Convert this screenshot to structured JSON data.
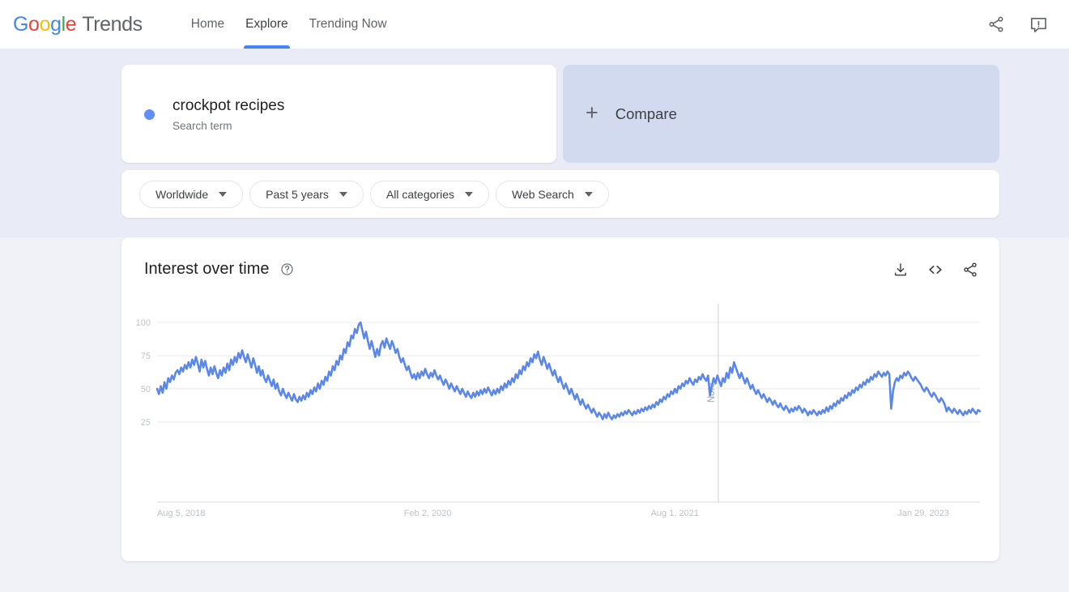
{
  "header": {
    "logo": {
      "google": "Google",
      "trends": "Trends"
    },
    "nav": [
      {
        "label": "Home",
        "active": false
      },
      {
        "label": "Explore",
        "active": true
      },
      {
        "label": "Trending Now",
        "active": false
      }
    ],
    "actions": [
      {
        "name": "share-icon",
        "label": "Share"
      },
      {
        "name": "feedback-icon",
        "label": "Send feedback"
      }
    ]
  },
  "search": {
    "term": "crockpot recipes",
    "type": "Search term",
    "dot_color": "#5e8ef7",
    "compare_label": "Compare",
    "compare_plus": "+"
  },
  "filters": [
    {
      "label": "Worldwide",
      "name": "region-filter"
    },
    {
      "label": "Past 5 years",
      "name": "time-filter"
    },
    {
      "label": "All categories",
      "name": "category-filter"
    },
    {
      "label": "Web Search",
      "name": "search-type-filter"
    }
  ],
  "chart_card": {
    "title": "Interest over time",
    "help": "?",
    "tools": [
      {
        "name": "download-icon",
        "label": "Download CSV"
      },
      {
        "name": "embed-icon",
        "label": "Embed"
      },
      {
        "name": "share-icon",
        "label": "Share"
      }
    ]
  },
  "chart_data": {
    "type": "line",
    "title": "Interest over time",
    "xlabel": "",
    "ylabel": "",
    "ylim": [
      0,
      108
    ],
    "yticks": [
      25,
      50,
      75,
      100
    ],
    "grid": true,
    "legend": false,
    "line_color": "#5b87e8",
    "xticks": [
      "Aug 5, 2018",
      "Feb 2, 2020",
      "Aug 1, 2021",
      "Jan 29, 2023"
    ],
    "xtick_positions": [
      0.0,
      0.3,
      0.6,
      0.9
    ],
    "annotations": [
      {
        "label": "Note",
        "x_fraction": 0.682,
        "type": "vertical-line"
      }
    ],
    "series": [
      {
        "name": "crockpot recipes",
        "values": [
          50,
          46,
          52,
          47,
          55,
          50,
          58,
          55,
          60,
          57,
          62,
          64,
          61,
          66,
          63,
          68,
          65,
          70,
          66,
          72,
          68,
          74,
          69,
          63,
          72,
          66,
          71,
          65,
          60,
          66,
          61,
          67,
          62,
          58,
          64,
          60,
          66,
          62,
          69,
          64,
          72,
          68,
          74,
          70,
          77,
          73,
          79,
          74,
          70,
          76,
          71,
          66,
          73,
          68,
          62,
          67,
          60,
          64,
          58,
          55,
          60,
          56,
          52,
          57,
          50,
          54,
          48,
          45,
          50,
          46,
          43,
          47,
          44,
          41,
          46,
          42,
          40,
          44,
          41,
          45,
          42,
          47,
          44,
          49,
          46,
          51,
          48,
          54,
          50,
          56,
          53,
          59,
          56,
          63,
          60,
          67,
          64,
          71,
          68,
          75,
          72,
          80,
          77,
          85,
          82,
          90,
          88,
          95,
          92,
          98,
          100,
          94,
          88,
          93,
          86,
          80,
          86,
          80,
          74,
          80,
          75,
          83,
          86,
          81,
          88,
          84,
          80,
          86,
          82,
          77,
          80,
          74,
          70,
          73,
          68,
          64,
          67,
          62,
          58,
          61,
          57,
          62,
          58,
          63,
          60,
          65,
          61,
          58,
          62,
          59,
          64,
          60,
          57,
          60,
          56,
          53,
          57,
          54,
          50,
          54,
          51,
          48,
          52,
          49,
          46,
          50,
          47,
          44,
          48,
          45,
          43,
          47,
          44,
          48,
          45,
          49,
          46,
          50,
          47,
          51,
          48,
          45,
          49,
          46,
          50,
          47,
          52,
          49,
          54,
          51,
          56,
          53,
          58,
          55,
          61,
          58,
          64,
          61,
          67,
          64,
          70,
          67,
          73,
          70,
          76,
          73,
          78,
          72,
          68,
          74,
          70,
          65,
          69,
          64,
          60,
          64,
          59,
          55,
          59,
          54,
          50,
          54,
          50,
          46,
          50,
          46,
          42,
          46,
          42,
          38,
          42,
          38,
          35,
          38,
          35,
          32,
          35,
          32,
          29,
          32,
          30,
          27,
          31,
          28,
          32,
          29,
          27,
          30,
          28,
          31,
          29,
          32,
          30,
          33,
          31,
          34,
          32,
          30,
          33,
          31,
          34,
          32,
          35,
          33,
          36,
          34,
          37,
          35,
          38,
          36,
          40,
          38,
          42,
          40,
          44,
          42,
          46,
          44,
          48,
          46,
          50,
          47,
          52,
          50,
          54,
          52,
          56,
          54,
          58,
          55,
          53,
          57,
          55,
          59,
          57,
          61,
          58,
          56,
          60,
          45,
          52,
          58,
          54,
          60,
          56,
          52,
          58,
          55,
          62,
          58,
          66,
          62,
          70,
          66,
          62,
          58,
          62,
          58,
          54,
          58,
          54,
          50,
          53,
          49,
          46,
          49,
          46,
          43,
          46,
          43,
          40,
          43,
          41,
          38,
          41,
          38,
          36,
          39,
          36,
          34,
          37,
          35,
          32,
          35,
          33,
          36,
          34,
          37,
          35,
          32,
          35,
          33,
          30,
          33,
          31,
          34,
          32,
          30,
          33,
          31,
          34,
          32,
          36,
          33,
          37,
          35,
          39,
          37,
          41,
          39,
          43,
          41,
          45,
          43,
          47,
          45,
          49,
          47,
          51,
          49,
          53,
          51,
          55,
          53,
          57,
          55,
          59,
          57,
          61,
          59,
          63,
          61,
          59,
          62,
          60,
          63,
          61,
          35,
          48,
          55,
          58,
          56,
          60,
          58,
          62,
          60,
          63,
          61,
          58,
          56,
          59,
          57,
          55,
          53,
          50,
          48,
          51,
          49,
          46,
          44,
          47,
          45,
          42,
          40,
          43,
          41,
          38,
          33,
          36,
          34,
          32,
          35,
          33,
          31,
          34,
          32,
          30,
          33,
          31,
          34,
          32,
          35,
          33,
          31,
          34,
          33
        ]
      }
    ]
  }
}
